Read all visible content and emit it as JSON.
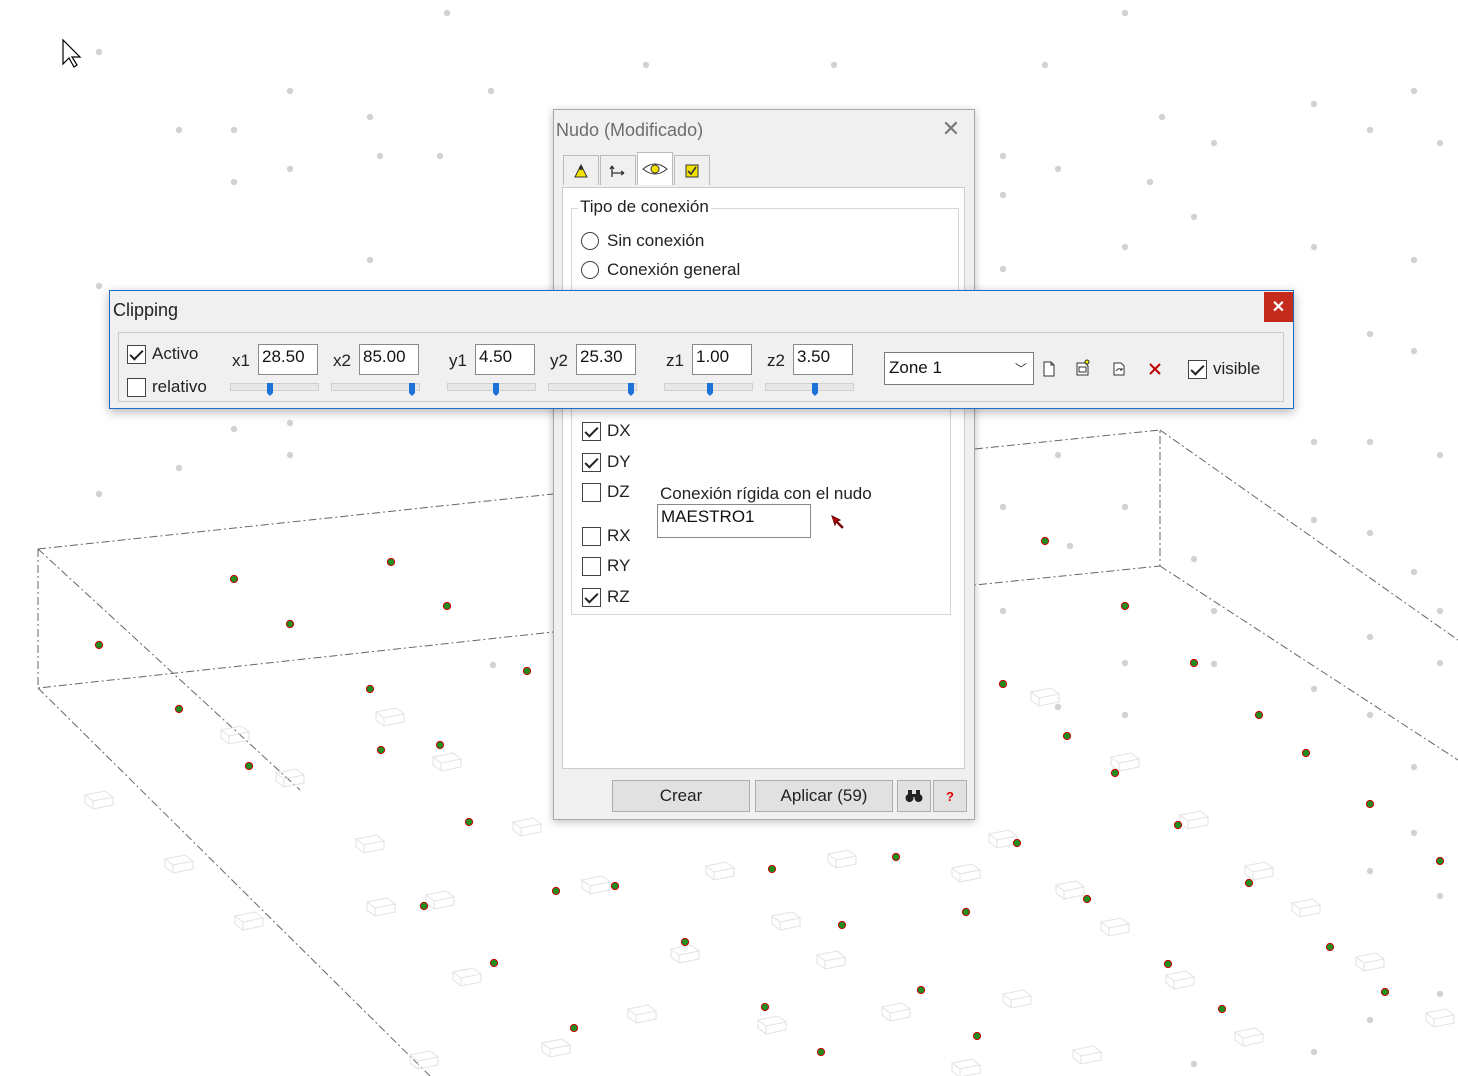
{
  "nodo_dialog": {
    "title": "Nudo (Modificado)",
    "tabs": [
      {
        "icon": "support-icon"
      },
      {
        "icon": "axes-icon"
      },
      {
        "icon": "connection-eye-icon"
      },
      {
        "icon": "checkbox-tab-icon"
      }
    ],
    "connection_group": {
      "title": "Tipo de conexión",
      "options": [
        {
          "label": "Sin conexión",
          "selected": false
        },
        {
          "label": "Conexión general",
          "selected": false
        }
      ]
    },
    "dof": [
      {
        "label": "DX",
        "checked": true
      },
      {
        "label": "DY",
        "checked": true
      },
      {
        "label": "DZ",
        "checked": false
      },
      {
        "label": "RX",
        "checked": false
      },
      {
        "label": "RY",
        "checked": false
      },
      {
        "label": "RZ",
        "checked": true
      }
    ],
    "rigid_label": "Conexión rígida con el nudo",
    "rigid_value": "MAESTRO1",
    "buttons": {
      "crear": "Crear",
      "aplicar": "Aplicar (59)",
      "help": "?"
    }
  },
  "clipping_dialog": {
    "title": "Clipping",
    "activo": {
      "label": "Activo",
      "checked": true
    },
    "relativo": {
      "label": "relativo",
      "checked": false
    },
    "fields": [
      {
        "label": "x1",
        "value": "28.50",
        "slider_fraction": 0.45
      },
      {
        "label": "x2",
        "value": "85.00",
        "slider_fraction": 0.95
      },
      {
        "label": "y1",
        "value": "4.50",
        "slider_fraction": 0.55
      },
      {
        "label": "y2",
        "value": "25.30",
        "slider_fraction": 0.97
      },
      {
        "label": "z1",
        "value": "1.00",
        "slider_fraction": 0.52
      },
      {
        "label": "z2",
        "value": "3.50",
        "slider_fraction": 0.57
      }
    ],
    "zone": "Zone 1",
    "visible": {
      "label": "visible",
      "checked": true
    },
    "tool_icons": [
      "new-page-icon",
      "edit-zone-icon",
      "refresh-zone-icon",
      "delete-icon"
    ]
  },
  "colors": {
    "node_fill": "#228b22",
    "node_stroke": "#cc0000",
    "close_red": "#c42b1c",
    "accent_blue": "#1e73d8"
  }
}
